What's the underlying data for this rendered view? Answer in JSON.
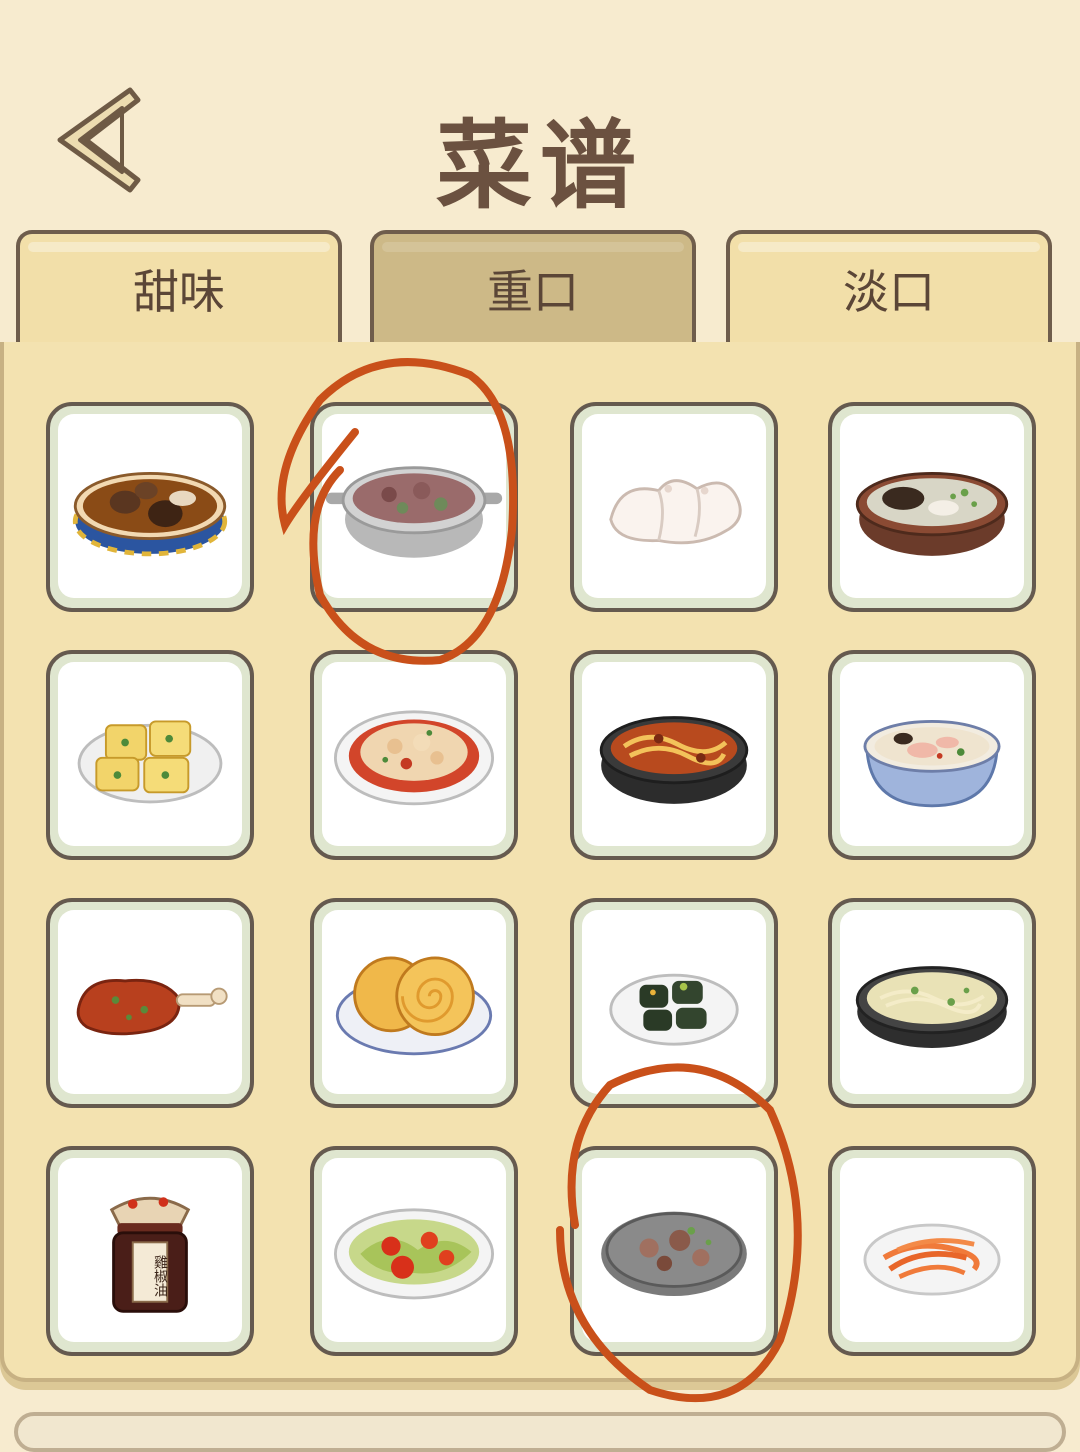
{
  "header": {
    "back_icon": "chevron-left-icon",
    "title": "菜谱"
  },
  "tabs": [
    {
      "label": "甜味",
      "active": false
    },
    {
      "label": "重口",
      "active": true
    },
    {
      "label": "淡口",
      "active": false
    }
  ],
  "dishes": [
    {
      "icon": "mushroom-soup-bowl-icon"
    },
    {
      "icon": "braised-meat-pot-icon"
    },
    {
      "icon": "dumplings-icon"
    },
    {
      "icon": "mushroom-soup-icon"
    },
    {
      "icon": "fried-tofu-icon"
    },
    {
      "icon": "spicy-chicken-plate-icon"
    },
    {
      "icon": "noodle-stew-icon"
    },
    {
      "icon": "pork-soup-bowl-icon"
    },
    {
      "icon": "roast-drumstick-icon"
    },
    {
      "icon": "spiral-pancakes-icon"
    },
    {
      "icon": "black-tofu-icon"
    },
    {
      "icon": "noodle-soup-icon"
    },
    {
      "icon": "chili-oil-jar-icon"
    },
    {
      "icon": "tomato-cabbage-icon"
    },
    {
      "icon": "lotus-root-stirfry-icon"
    },
    {
      "icon": "shredded-carrot-icon"
    }
  ],
  "jar_label": "雞椒油",
  "colors": {
    "background": "#f7ebcf",
    "panel": "#f3e2b0",
    "card_border": "#dfe6cf",
    "annotation": "#c9501a"
  }
}
